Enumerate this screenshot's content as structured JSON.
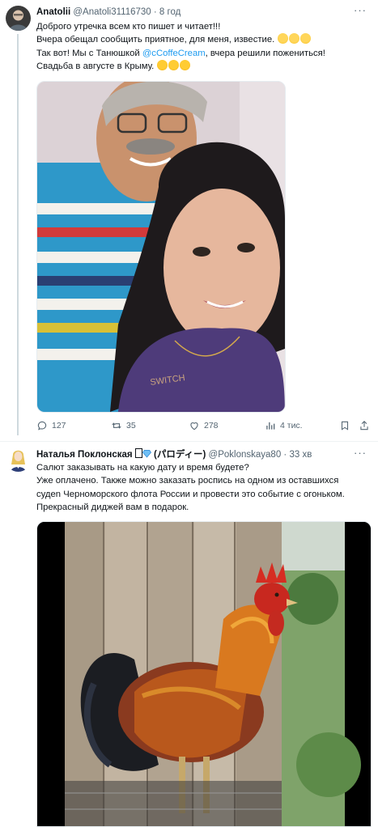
{
  "tweet1": {
    "author_name": "Anatolii",
    "handle": "@Anatoli31116730",
    "sep": "·",
    "time": "8 год",
    "more": "···",
    "lines": {
      "l1": "Доброго утречка всем кто пишет и читает!!!",
      "l2": "Вчера обещал сообщить приятное, для меня, известие.",
      "l3a": "Так вот! Мы с  Танюшкой ",
      "l3_mention": "@cCoffeCream",
      "l3b": ", вчера решили пожениться!",
      "l4": "Свадьба в августе в Крыму."
    },
    "stats": {
      "replies": "127",
      "reposts": "35",
      "likes": "278",
      "views": "4 тис."
    }
  },
  "tweet2": {
    "author_name": "Наталья Поклонская",
    "name_suffix": "(パロディー)",
    "handle": "@Poklonskaya80",
    "sep": "·",
    "time": "33 хв",
    "more": "···",
    "lines": {
      "l1": "Салют заказывать на какую дату и время будете?",
      "l2": "Уже оплачено. Также можно заказать роспись на одном из оставшихся",
      "l3": "судеn Черноморского флота России и провести это событие с огоньком.",
      "l4": "Прекрасный диджей вам в подарок."
    }
  },
  "icons": {
    "reply": "reply-icon",
    "repost": "repost-icon",
    "like": "heart-icon",
    "views": "views-icon",
    "bookmark": "bookmark-icon",
    "share": "share-icon",
    "verified": "diamond-icon"
  },
  "colors": {
    "link": "#1d9bf0",
    "muted": "#536471",
    "text": "#0f1419"
  }
}
